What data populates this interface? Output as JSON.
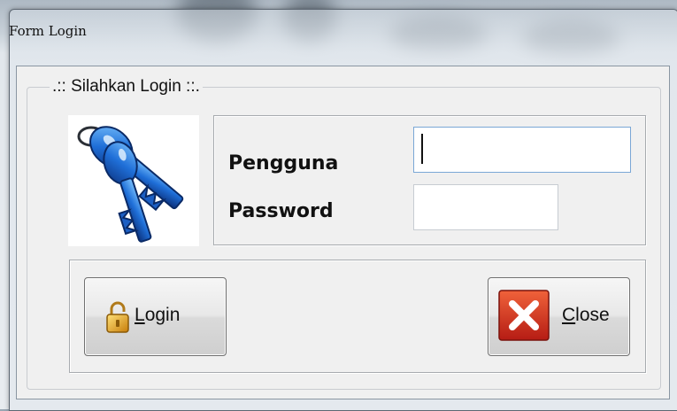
{
  "window": {
    "title": "Form Login"
  },
  "group": {
    "legend": ".:: Silahkan Login ::."
  },
  "fields": {
    "username_label": "Pengguna",
    "username_value": "",
    "password_label": "Password",
    "password_value": ""
  },
  "buttons": {
    "login": {
      "mnemonic": "L",
      "rest": "ogin"
    },
    "close": {
      "mnemonic": "C",
      "rest": "lose"
    }
  },
  "icons": {
    "keys": "keys-icon",
    "lock": "padlock-icon",
    "close": "red-x-icon"
  },
  "colors": {
    "accent_blue": "#2a6fd6",
    "close_red": "#d9302a",
    "lock_gold": "#e0a020"
  }
}
